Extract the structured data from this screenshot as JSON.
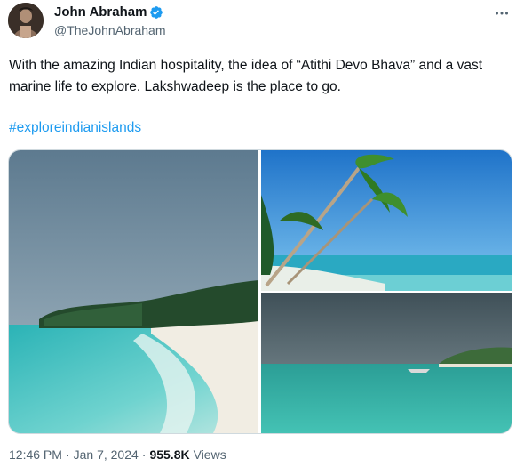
{
  "author": {
    "display_name": "John Abraham",
    "handle": "@TheJohnAbraham",
    "avatar_icon": "avatar-photo",
    "verified_icon": "verified-badge-icon",
    "verified_color": "#1d9bf0"
  },
  "tweet": {
    "text": "With the amazing Indian hospitality, the idea of “Atithi Devo Bhava” and a vast marine life to explore. Lakshwadeep is the place to go.",
    "hashtag": "#exploreindianislands",
    "hashtag_color": "#1d9bf0"
  },
  "media": {
    "images": [
      {
        "name": "beach-shore-photo"
      },
      {
        "name": "palm-trees-beach-photo"
      },
      {
        "name": "lagoon-boat-photo"
      }
    ]
  },
  "meta": {
    "time": "12:46 PM",
    "separator": "·",
    "date": "Jan 7, 2024",
    "views_count": "955.8K",
    "views_label": "Views"
  },
  "more_icon": "more-options-icon"
}
